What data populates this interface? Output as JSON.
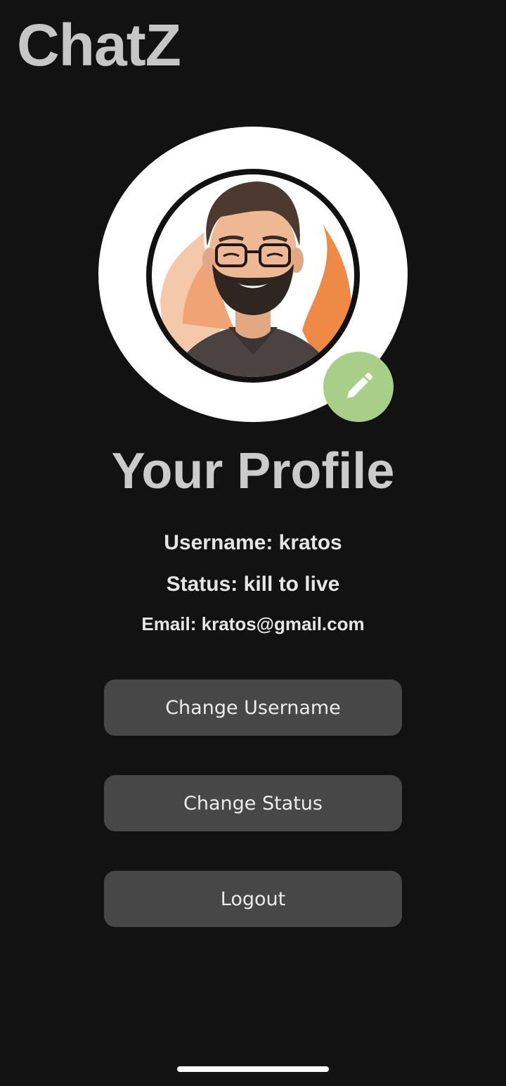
{
  "app": {
    "title": "ChatZ"
  },
  "avatar": {
    "description": "profile-avatar",
    "edit_icon": "pencil-icon",
    "edit_color": "#a8cf88"
  },
  "profile": {
    "heading": "Your Profile",
    "username_line": "Username: kratos",
    "status_line": "Status: kill to live",
    "email_line": "Email: kratos@gmail.com"
  },
  "actions": {
    "change_username": "Change Username",
    "change_status": "Change Status",
    "logout": "Logout"
  },
  "colors": {
    "background": "#121212",
    "button": "#474747",
    "title": "#c6c6c6"
  }
}
